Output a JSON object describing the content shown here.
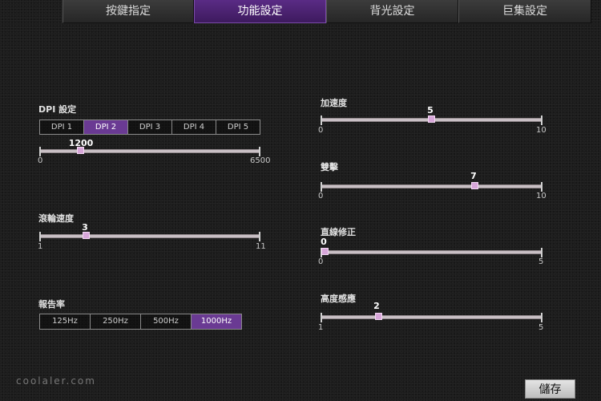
{
  "tabs": [
    {
      "label": "按鍵指定",
      "active": false
    },
    {
      "label": "功能設定",
      "active": true
    },
    {
      "label": "背光設定",
      "active": false
    },
    {
      "label": "巨集設定",
      "active": false
    }
  ],
  "dpi": {
    "label": "DPI 設定",
    "buttons": [
      "DPI 1",
      "DPI 2",
      "DPI 3",
      "DPI 4",
      "DPI 5"
    ],
    "selected": "DPI 2",
    "slider": {
      "value": "1200",
      "min": "0",
      "max": "6500"
    }
  },
  "scroll": {
    "label": "滾輪速度",
    "slider": {
      "value": "3",
      "min": "1",
      "max": "11"
    }
  },
  "report": {
    "label": "報告率",
    "buttons": [
      "125Hz",
      "250Hz",
      "500Hz",
      "1000Hz"
    ],
    "selected": "1000Hz"
  },
  "accel": {
    "label": "加速度",
    "slider": {
      "value": "5",
      "min": "0",
      "max": "10"
    }
  },
  "dblclick": {
    "label": "雙擊",
    "slider": {
      "value": "7",
      "min": "0",
      "max": "10"
    }
  },
  "straight": {
    "label": "直線修正",
    "slider": {
      "value": "0",
      "min": "0",
      "max": "5"
    }
  },
  "lift": {
    "label": "高度感應",
    "slider": {
      "value": "2",
      "min": "1",
      "max": "5"
    }
  },
  "save_label": "儲存",
  "watermark": "coolaler.com",
  "colors": {
    "accent": "#6a3a93",
    "thumb": "#d7a6d9"
  }
}
